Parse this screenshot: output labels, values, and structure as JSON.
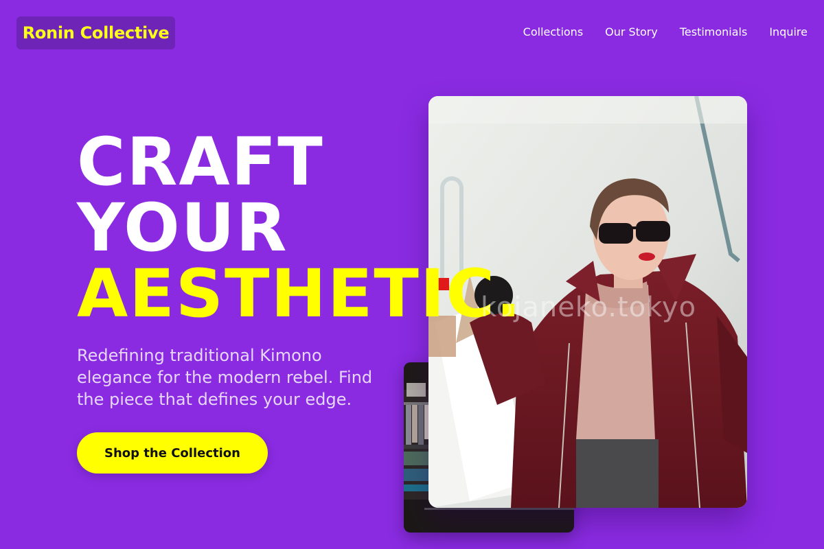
{
  "brand": {
    "name": "Ronin Collective"
  },
  "nav": {
    "items": [
      {
        "label": "Collections"
      },
      {
        "label": "Our Story"
      },
      {
        "label": "Testimonials"
      },
      {
        "label": "Inquire"
      }
    ]
  },
  "hero": {
    "title_line1": "CRAFT",
    "title_line2": "YOUR",
    "title_line3": "AESTHETIC.",
    "subtitle": "Redefining traditional Kimono elegance for the modern rebel. Find the piece that defines your edge.",
    "cta_label": "Shop the Collection"
  },
  "images": {
    "main_watermark": "kojaneko.tokyo"
  },
  "colors": {
    "background": "#8a2be2",
    "accent": "#ffff00",
    "logo_bg": "#6f24b8"
  }
}
